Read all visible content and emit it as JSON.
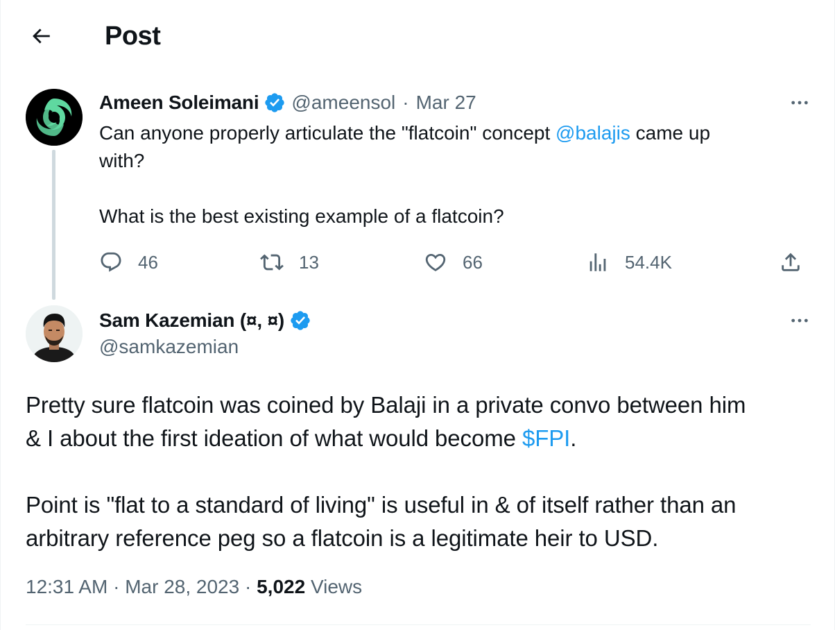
{
  "header": {
    "title": "Post",
    "back_icon": "arrow-left-icon"
  },
  "parent_tweet": {
    "display_name": "Ameen Soleimani",
    "handle": "@ameensol",
    "separator": "·",
    "date": "Mar 27",
    "text_before_link": "Can anyone properly articulate the \"flatcoin\" concept ",
    "link_text": "@balajis",
    "text_after_link": " came up\nwith?\n\nWhat is the best existing example of a flatcoin?",
    "replies": "46",
    "reposts": "13",
    "likes": "66",
    "views": "54.4K"
  },
  "main_tweet": {
    "display_name": "Sam Kazemian (¤, ¤)",
    "handle": "@samkazemian",
    "text_before_link": "Pretty sure flatcoin was coined by Balaji in a private convo between him\n& I about the first ideation of what would become ",
    "link_text": "$FPI",
    "text_after_link": ".\n\nPoint is \"flat to a standard of living\" is useful in & of itself rather than an\narbitrary reference peg so a flatcoin is a legitimate heir to USD.",
    "time": "12:31 AM",
    "separator_1": " · ",
    "date": "Mar 28, 2023",
    "separator_2": " · ",
    "views_count": "5,022",
    "views_label": "Views"
  },
  "colors": {
    "accent": "#1d9bf0",
    "text": "#0f1419",
    "muted": "#536471",
    "thread_line": "#cfd9de",
    "logo_green": "#5fd8a0"
  }
}
